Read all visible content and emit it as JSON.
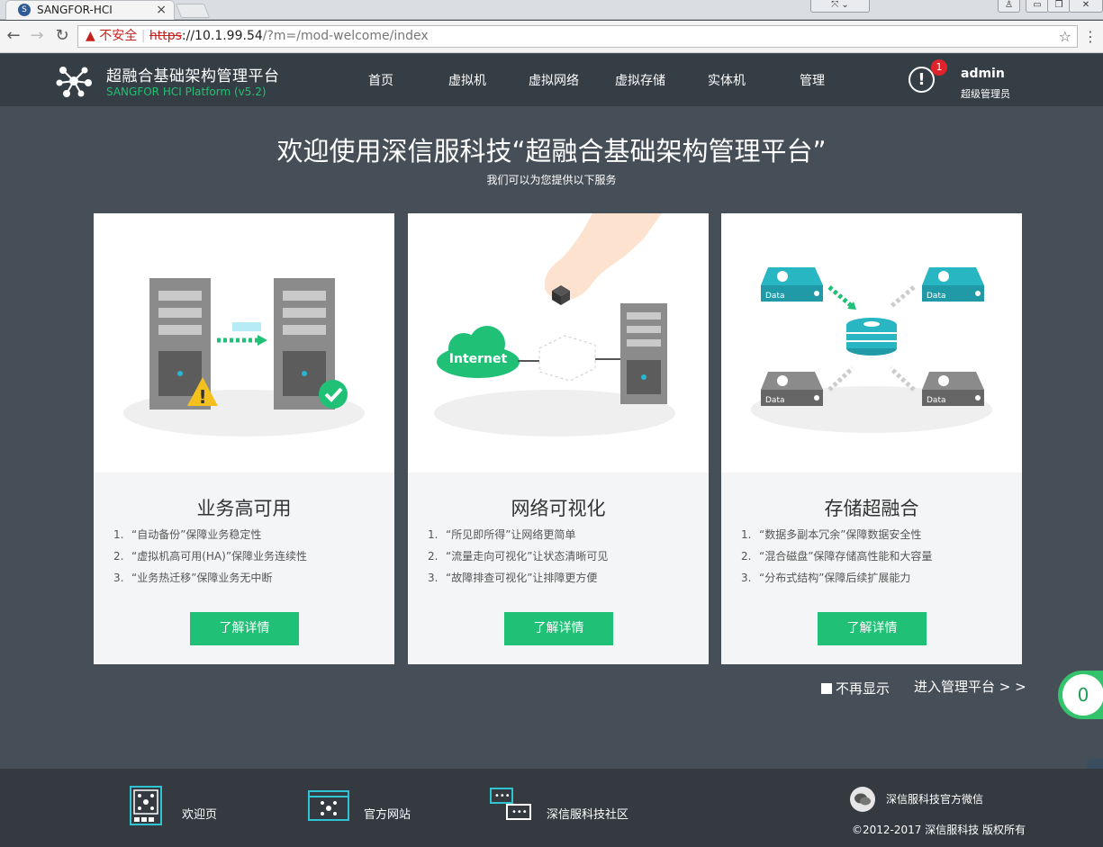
{
  "browser": {
    "tab_title": "SANGFOR-HCI",
    "tab_close": "×",
    "security_label": "不安全",
    "url_protocol": "https",
    "url_host": "://10.1.99.54",
    "url_path": "/?m=/mod-welcome/index",
    "bookmark_icon": "☆"
  },
  "header": {
    "title": "超融合基础架构管理平台",
    "subtitle": "SANGFOR HCI Platform (v5.2)",
    "nav": [
      "首页",
      "虚拟机",
      "虚拟网络",
      "虚拟存储",
      "实体机",
      "管理"
    ],
    "alert_symbol": "!",
    "alert_count": "1",
    "user": "admin",
    "role": "超级管理员"
  },
  "hero": {
    "title": "欢迎使用深信服科技“超融合基础架构管理平台”",
    "subtitle": "我们可以为您提供以下服务"
  },
  "cards": [
    {
      "title": "业务高可用",
      "items": [
        {
          "n": "1.",
          "text": "“自动备份”保障业务稳定性"
        },
        {
          "n": "2.",
          "text": "“虚拟机高可用(HA)”保障业务连续性"
        },
        {
          "n": "3.",
          "text": "“业务热迁移”保障业务无中断"
        }
      ],
      "button": "了解详情"
    },
    {
      "title": "网络可视化",
      "illu_label": "Internet",
      "items": [
        {
          "n": "1.",
          "text": "“所见即所得”让网络更简单"
        },
        {
          "n": "2.",
          "text": "“流量走向可视化”让状态清晰可见"
        },
        {
          "n": "3.",
          "text": "“故障排查可视化”让排障更方便"
        }
      ],
      "button": "了解详情"
    },
    {
      "title": "存储超融合",
      "illu_label": "Data",
      "items": [
        {
          "n": "1.",
          "text": "“数据多副本冗余”保障数据安全性"
        },
        {
          "n": "2.",
          "text": "“混合磁盘”保障存储高性能和大容量"
        },
        {
          "n": "3.",
          "text": "“分布式结构”保障后续扩展能力"
        }
      ],
      "button": "了解详情"
    }
  ],
  "controls": {
    "no_more_label": "不再显示",
    "enter_label": "进入管理平台 > >",
    "side_widget_value": "0"
  },
  "footer": {
    "links": [
      "欢迎页",
      "官方网站",
      "深信服科技社区"
    ],
    "wechat": "深信服科技官方微信",
    "copyright": "©2012-2017 深信服科技   版权所有"
  }
}
